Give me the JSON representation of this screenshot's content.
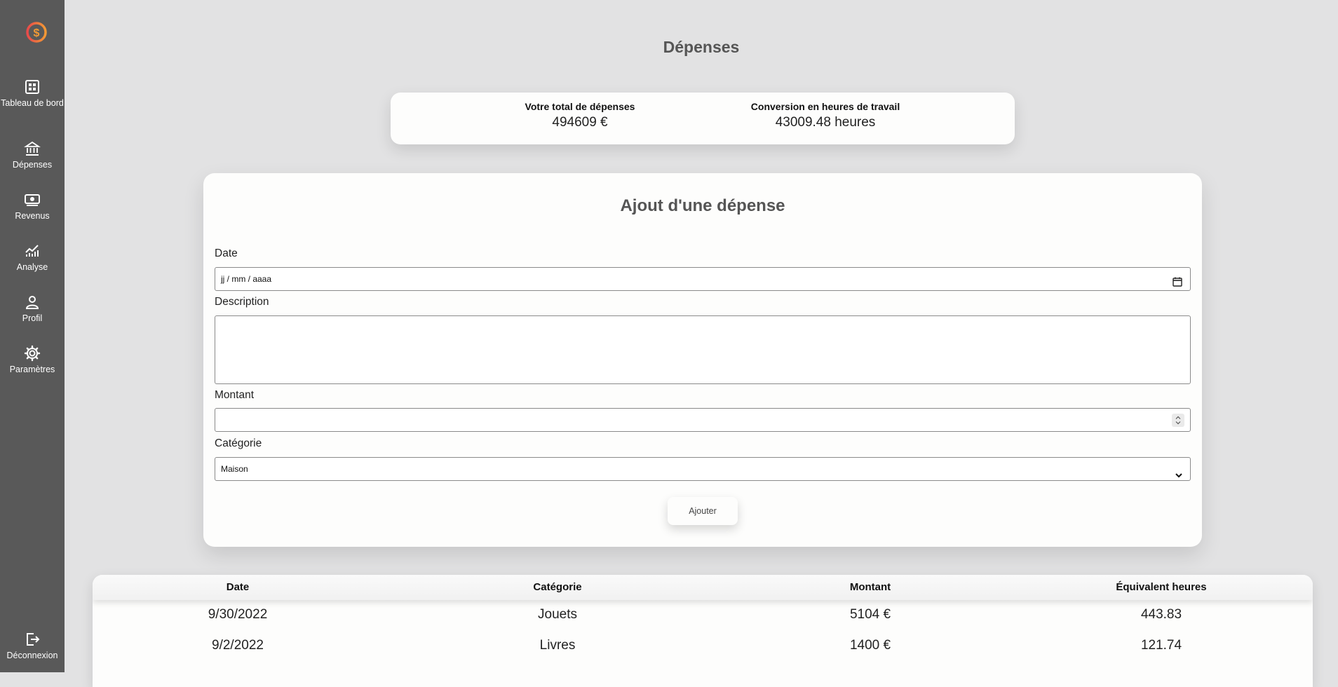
{
  "sidebar": {
    "logo": "dollar-speed-logo",
    "items": [
      {
        "label": "Tableau de bord",
        "icon": "dashboard-icon"
      },
      {
        "label": "Dépenses",
        "icon": "bank-icon"
      },
      {
        "label": "Revenus",
        "icon": "cash-icon"
      },
      {
        "label": "Analyse",
        "icon": "chart-line-icon"
      },
      {
        "label": "Profil",
        "icon": "person-icon"
      },
      {
        "label": "Paramètres",
        "icon": "gear-icon"
      }
    ],
    "logout": {
      "label": "Déconnexion",
      "icon": "logout-icon"
    }
  },
  "page": {
    "title": "Dépenses"
  },
  "summary": {
    "total_label": "Votre total de dépenses",
    "total_value": "494609 €",
    "hours_label": "Conversion en heures de travail",
    "hours_value": "43009.48 heures"
  },
  "form": {
    "title": "Ajout d'une dépense",
    "date_label": "Date",
    "date_placeholder": "jj / mm / aaaa",
    "description_label": "Description",
    "description_value": "",
    "amount_label": "Montant",
    "amount_value": "",
    "category_label": "Catégorie",
    "category_selected": "Maison",
    "submit_label": "Ajouter"
  },
  "table": {
    "headers": [
      "Date",
      "Catégorie",
      "Montant",
      "Équivalent heures"
    ],
    "rows": [
      [
        "9/30/2022",
        "Jouets",
        "5104 €",
        "443.83"
      ],
      [
        "9/2/2022",
        "Livres",
        "1400 €",
        "121.74"
      ]
    ]
  },
  "colors": {
    "sidebar_bg": "#595959",
    "page_bg": "#e2e2e3",
    "card_bg": "#fdfdfc",
    "logo_red": "#e84a4a",
    "logo_orange": "#f29a35"
  }
}
